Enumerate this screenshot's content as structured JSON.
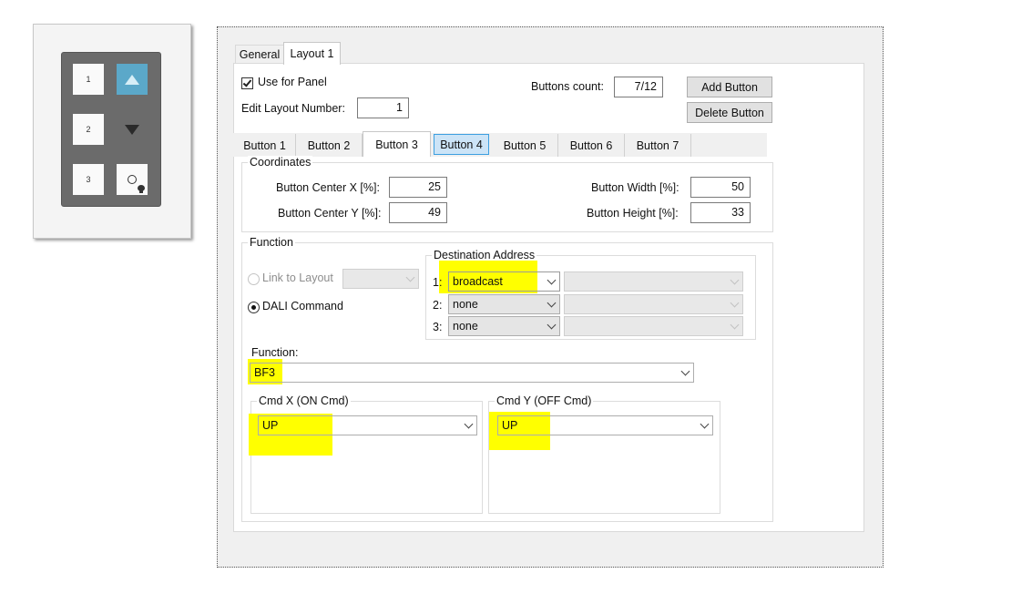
{
  "preview": {
    "buttons": [
      {
        "label": "1"
      },
      {
        "label": "2"
      },
      {
        "label": "3"
      }
    ]
  },
  "dialog": {
    "tabs": [
      "General",
      "Layout 1"
    ],
    "use_for_panel_label": "Use for Panel",
    "use_for_panel_checked": true,
    "edit_layout_label": "Edit Layout Number:",
    "edit_layout_value": "1",
    "buttons_count_label": "Buttons count:",
    "buttons_count_value": "7/12",
    "add_button_label": "Add Button",
    "delete_button_label": "Delete Button",
    "button_tabs": [
      "Button 1",
      "Button 2",
      "Button 3",
      "Button 4",
      "Button 5",
      "Button 6",
      "Button 7"
    ],
    "selected_button_tab": "Button 3",
    "coordinates": {
      "title": "Coordinates",
      "center_x_label": "Button Center X [%]:",
      "center_x_value": "25",
      "center_y_label": "Button Center Y [%]:",
      "center_y_value": "49",
      "width_label": "Button Width [%]:",
      "width_value": "50",
      "height_label": "Button Height [%]:",
      "height_value": "33"
    },
    "function_group": {
      "title": "Function",
      "link_to_layout_label": "Link to Layout",
      "dali_command_label": "DALI Command",
      "dali_command_selected": true,
      "destination": {
        "title": "Destination Address",
        "rows": [
          {
            "index": "1:",
            "value": "broadcast"
          },
          {
            "index": "2:",
            "value": "none"
          },
          {
            "index": "3:",
            "value": "none"
          }
        ]
      },
      "function_label": "Function:",
      "function_value": "BF3",
      "cmd_x_title": "Cmd X  (ON Cmd)",
      "cmd_x_value": "UP",
      "cmd_y_title": "Cmd Y  (OFF Cmd)",
      "cmd_y_value": "UP"
    }
  },
  "colors": {
    "highlight": "#ffff00",
    "accent": "#5ba8c9",
    "tab_hover": "#cce4f7"
  }
}
